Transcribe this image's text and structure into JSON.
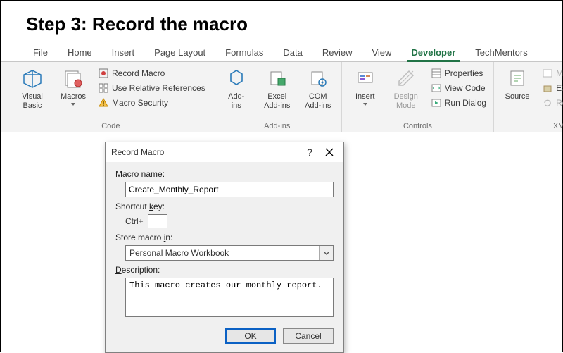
{
  "heading": "Step 3: Record the macro",
  "tabs": [
    "File",
    "Home",
    "Insert",
    "Page Layout",
    "Formulas",
    "Data",
    "Review",
    "View",
    "Developer",
    "TechMentors"
  ],
  "active_tab_index": 8,
  "ribbon": {
    "code": {
      "visual_basic": "Visual\nBasic",
      "macros": "Macros",
      "record_macro": "Record Macro",
      "use_relative": "Use Relative References",
      "macro_security": "Macro Security",
      "group_label": "Code"
    },
    "addins": {
      "addins_btn": "Add-\nins",
      "excel_addins": "Excel\nAdd-ins",
      "com_addins": "COM\nAdd-ins",
      "group_label": "Add-ins"
    },
    "controls": {
      "insert": "Insert",
      "design_mode": "Design\nMode",
      "properties": "Properties",
      "view_code": "View Code",
      "run_dialog": "Run Dialog",
      "group_label": "Controls"
    },
    "xml": {
      "source": "Source",
      "map_properties": "Map Properties",
      "expansion_packs": "Expansion Packs",
      "refresh_data": "Refresh Data",
      "group_label": "XML"
    }
  },
  "dialog": {
    "title": "Record Macro",
    "label_macro_name": "Macro name:",
    "macro_name_value": "Create_Monthly_Report",
    "label_shortcut": "Shortcut key:",
    "ctrl_prefix": "Ctrl+",
    "shortcut_value": "",
    "label_store": "Store macro in:",
    "store_value": "Personal Macro Workbook",
    "label_description": "Description:",
    "description_value": "This macro creates our monthly report.",
    "ok_label": "OK",
    "cancel_label": "Cancel"
  }
}
